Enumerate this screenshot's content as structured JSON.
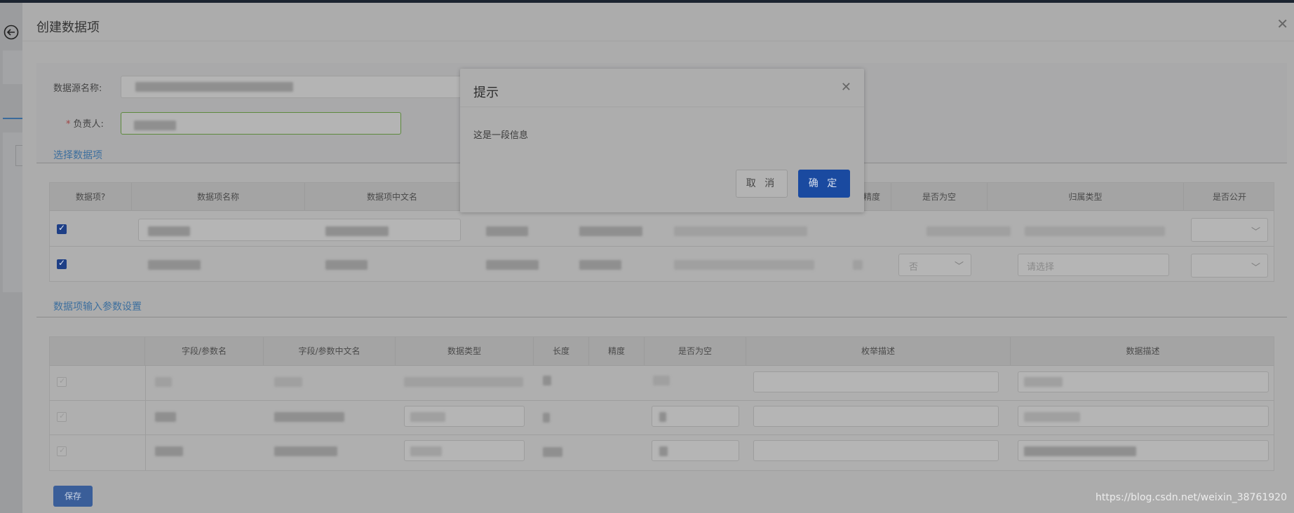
{
  "drawer": {
    "title": "创建数据项",
    "close_icon": "close-icon"
  },
  "form": {
    "datasource_label": "数据源名称:",
    "owner_label": "负责人:",
    "owner_required_mark": "*"
  },
  "section1": {
    "title": "选择数据项",
    "headers": [
      "数据项?",
      "数据项名称",
      "数据项中文名",
      "精度",
      "是否为空",
      "归属类型",
      "是否公开"
    ],
    "row2_nullable_value": "否",
    "row2_category_placeholder": "请选择"
  },
  "section2": {
    "title": "数据项输入参数设置",
    "headers": [
      "字段/参数名",
      "字段/参数中文名",
      "数据类型",
      "长度",
      "精度",
      "是否为空",
      "枚举描述",
      "数据描述"
    ]
  },
  "save_button": "保存",
  "modal": {
    "title": "提示",
    "message": "这是一段信息",
    "cancel_label": "取 消",
    "ok_label": "确 定"
  },
  "watermark": "https://blog.csdn.net/weixin_38761920",
  "colors": {
    "primary": "#1a4aa0",
    "link": "#3d6f9e",
    "overlay_bg": "#acacac"
  }
}
